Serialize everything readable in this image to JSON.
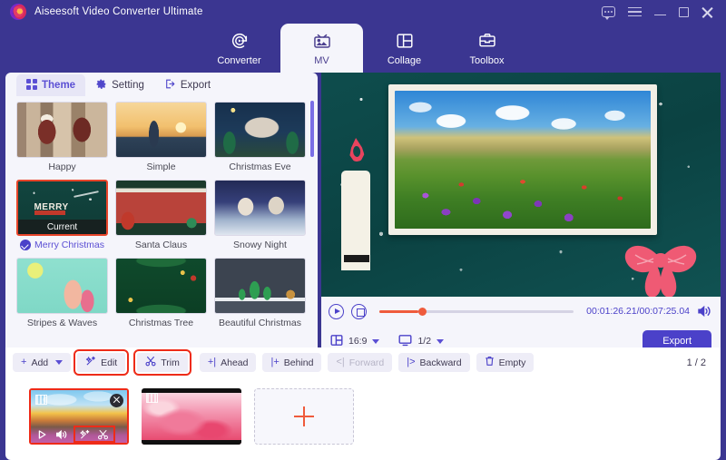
{
  "window": {
    "app_title": "Aiseesoft Video Converter Ultimate",
    "controls": [
      {
        "name": "feedback-icon",
        "label": "Feedback"
      },
      {
        "name": "menu-icon",
        "label": "Menu"
      },
      {
        "name": "minimize-icon",
        "label": "Minimize"
      },
      {
        "name": "maximize-icon",
        "label": "Maximize"
      },
      {
        "name": "close-icon",
        "label": "Close"
      }
    ]
  },
  "nav": {
    "tabs": [
      {
        "label": "Converter",
        "icon": "converter-icon",
        "active": false
      },
      {
        "label": "MV",
        "icon": "mv-icon",
        "active": true
      },
      {
        "label": "Collage",
        "icon": "collage-icon",
        "active": false
      },
      {
        "label": "Toolbox",
        "icon": "toolbox-icon",
        "active": false
      }
    ]
  },
  "subtabs": [
    {
      "label": "Theme",
      "icon": "grid-icon",
      "active": true
    },
    {
      "label": "Setting",
      "icon": "gear-icon",
      "active": false
    },
    {
      "label": "Export",
      "icon": "export-icon",
      "active": false
    }
  ],
  "themes": [
    {
      "label": "Happy",
      "selected": false,
      "badge": ""
    },
    {
      "label": "Simple",
      "selected": false,
      "badge": ""
    },
    {
      "label": "Christmas Eve",
      "selected": false,
      "badge": ""
    },
    {
      "label": "Merry Christmas",
      "selected": true,
      "badge": "Current"
    },
    {
      "label": "Santa Claus",
      "selected": false,
      "badge": ""
    },
    {
      "label": "Snowy Night",
      "selected": false,
      "badge": ""
    },
    {
      "label": "Stripes & Waves",
      "selected": false,
      "badge": ""
    },
    {
      "label": "Christmas Tree",
      "selected": false,
      "badge": ""
    },
    {
      "label": "Beautiful Christmas",
      "selected": false,
      "badge": ""
    }
  ],
  "player": {
    "play_label": "Play",
    "stop_label": "Stop",
    "progress_percent": 20,
    "timecode": "00:01:26.21/00:07:25.04",
    "volume_label": "Volume",
    "aspect_ratio": "16:9",
    "split_value": "1/2",
    "export_label": "Export"
  },
  "toolbar": {
    "buttons": [
      {
        "label": "Add",
        "icon": "plus-icon",
        "disabled": false,
        "highlighted": false,
        "has_caret": true
      },
      {
        "label": "Edit",
        "icon": "magic-wand-icon",
        "disabled": false,
        "highlighted": true,
        "has_caret": false
      },
      {
        "label": "Trim",
        "icon": "scissors-icon",
        "disabled": false,
        "highlighted": true,
        "has_caret": false
      },
      {
        "label": "Ahead",
        "icon": "move-ahead-icon",
        "disabled": false,
        "highlighted": false,
        "has_caret": false
      },
      {
        "label": "Behind",
        "icon": "move-behind-icon",
        "disabled": false,
        "highlighted": false,
        "has_caret": false
      },
      {
        "label": "Forward",
        "icon": "forward-icon",
        "disabled": true,
        "highlighted": false,
        "has_caret": false
      },
      {
        "label": "Backward",
        "icon": "backward-icon",
        "disabled": false,
        "highlighted": false,
        "has_caret": false
      },
      {
        "label": "Empty",
        "icon": "trash-icon",
        "disabled": false,
        "highlighted": false,
        "has_caret": false
      }
    ],
    "page_indicator": "1 / 2"
  },
  "timeline": {
    "clips": [
      {
        "name": "clip-sunset-mountains",
        "active": true,
        "has_close": true,
        "tools": [
          "play-icon",
          "volume-icon",
          "magic-wand-icon",
          "scissors-icon"
        ]
      },
      {
        "name": "clip-pink-abstract",
        "active": false,
        "has_close": false,
        "tools": []
      }
    ],
    "add_label": "Add media"
  },
  "colors": {
    "header_purple": "#3b3691",
    "accent_purple": "#4b41c9",
    "highlight_red": "#ee2b18",
    "progress_orange": "#ef5b3c",
    "panel_bg": "#f5f5fb"
  }
}
